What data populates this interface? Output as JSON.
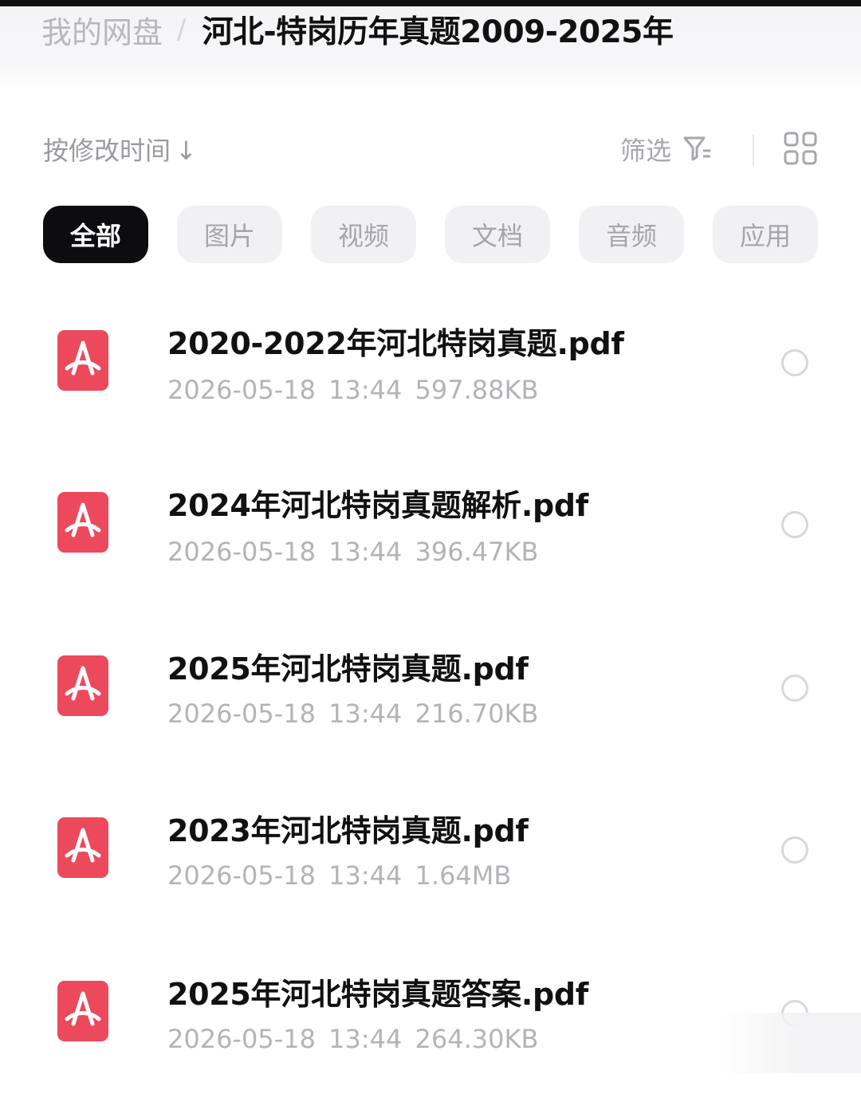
{
  "breadcrumb": {
    "root": "我的网盘",
    "separator": "/",
    "current": "河北-特岗历年真题2009-2025年"
  },
  "toolbar": {
    "sort_label": "按修改时间",
    "sort_arrow": "↓",
    "filter_label": "筛选",
    "filter_icon": "filter-icon",
    "view_icon": "grid-view-icon"
  },
  "tabs": [
    {
      "label": "全部",
      "active": true
    },
    {
      "label": "图片",
      "active": false
    },
    {
      "label": "视频",
      "active": false
    },
    {
      "label": "文档",
      "active": false
    },
    {
      "label": "音频",
      "active": false
    },
    {
      "label": "应用",
      "active": false
    }
  ],
  "files": [
    {
      "name": "2020-2022年河北特岗真题.pdf",
      "date": "2026-05-18",
      "time": "13:44",
      "size": "597.88KB",
      "icon": "pdf-icon"
    },
    {
      "name": "2024年河北特岗真题解析.pdf",
      "date": "2026-05-18",
      "time": "13:44",
      "size": "396.47KB",
      "icon": "pdf-icon"
    },
    {
      "name": "2025年河北特岗真题.pdf",
      "date": "2026-05-18",
      "time": "13:44",
      "size": "216.70KB",
      "icon": "pdf-icon"
    },
    {
      "name": "2023年河北特岗真题.pdf",
      "date": "2026-05-18",
      "time": "13:44",
      "size": "1.64MB",
      "icon": "pdf-icon"
    },
    {
      "name": "2025年河北特岗真题答案.pdf",
      "date": "2026-05-18",
      "time": "13:44",
      "size": "264.30KB",
      "icon": "pdf-icon"
    }
  ],
  "colors": {
    "pdf_icon": "#ec4a5c",
    "active_tab_bg": "#0d0d10",
    "inactive_tab_bg": "#f1f1f4",
    "muted_text": "#b4b4b8"
  }
}
